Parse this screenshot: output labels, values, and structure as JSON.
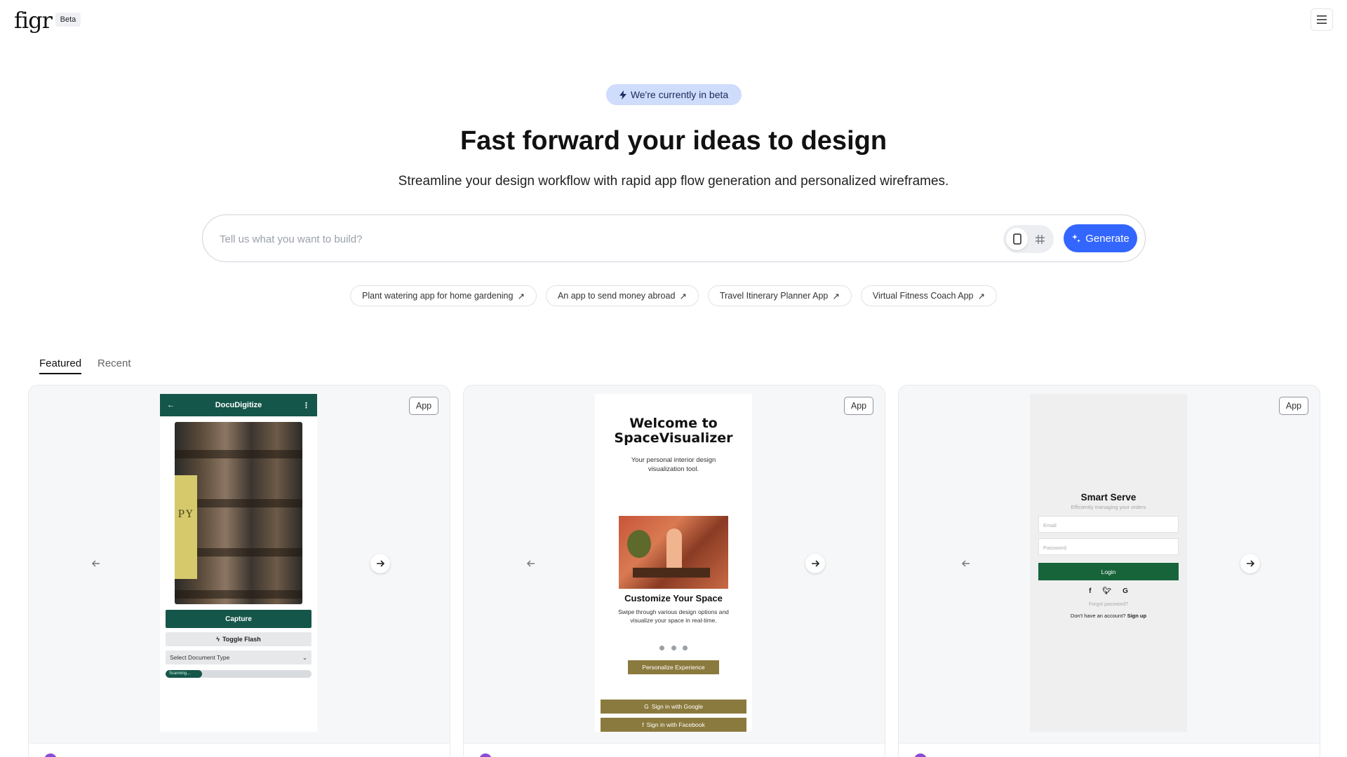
{
  "header": {
    "logo": "figr",
    "beta_badge": "Beta",
    "menu_icon": "hamburger-icon"
  },
  "hero": {
    "beta_pill": "We're currently in beta",
    "headline": "Fast forward your ideas to design",
    "subheadline": "Streamline your design workflow with rapid app flow generation and personalized wireframes."
  },
  "prompt": {
    "placeholder": "Tell us what you want to build?",
    "toggle_options": [
      "mobile-icon",
      "grid-icon"
    ],
    "generate_label": "Generate"
  },
  "suggestions": [
    "Plant watering app for home gardening",
    "An app to send money abroad",
    "Travel Itinerary Planner App",
    "Virtual Fitness Coach App"
  ],
  "tabs": [
    {
      "label": "Featured",
      "active": true
    },
    {
      "label": "Recent",
      "active": false
    }
  ],
  "cards": [
    {
      "badge": "App",
      "screen": {
        "header_title": "DocuDigitize",
        "book_letters": "PY",
        "capture_label": "Capture",
        "flash_label": "Toggle Flash",
        "select_label": "Select Document Type",
        "progress_label": "Scanning...",
        "progress_fraction": 0.25
      }
    },
    {
      "badge": "App",
      "screen": {
        "title": "Welcome to SpaceVisualizer",
        "subtitle": "Your personal interior design visualization tool.",
        "heading": "Customize Your Space",
        "description": "Swipe through various design options and visualize your space in real-time.",
        "personalize_label": "Personalize Experience",
        "google_label": "Sign in with Google",
        "facebook_label": "Sign in with Facebook"
      }
    },
    {
      "badge": "App",
      "screen": {
        "title": "Smart Serve",
        "subtitle": "Efficiently managing your orders",
        "email_placeholder": "Email",
        "password_placeholder": "Password",
        "login_label": "Login",
        "forgot_label": "Forgot password?",
        "signup_prefix": "Don't have an account?",
        "signup_link": "Sign up"
      }
    }
  ],
  "colors": {
    "accent": "#3366ff",
    "beta_pill_bg": "#cfdcfb",
    "docu_green": "#15564a",
    "space_olive": "#8b7a3e",
    "serve_green": "#17643a"
  }
}
